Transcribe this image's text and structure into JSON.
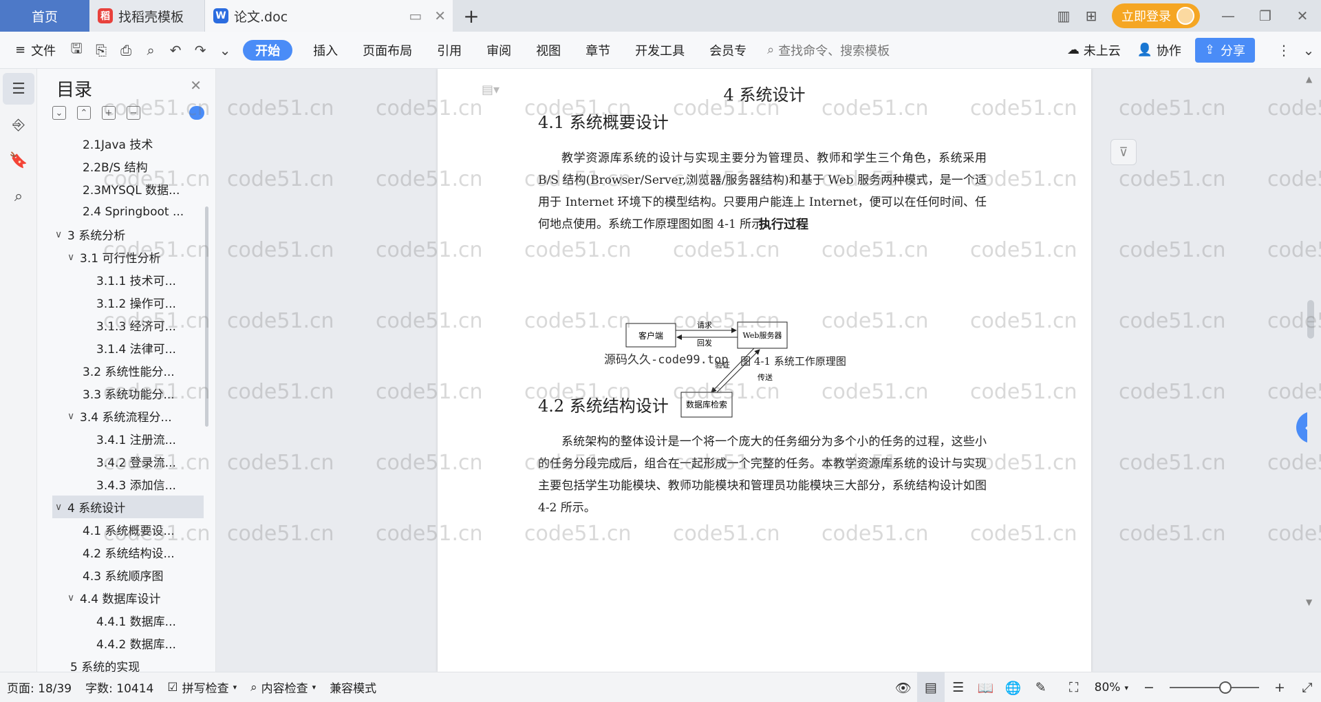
{
  "tabs": {
    "home": "首页",
    "template": "找稻壳模板",
    "doc": "论文.doc",
    "plus": "+"
  },
  "header": {
    "login": "立即登录"
  },
  "ribbon": {
    "file": "文件",
    "tabs": [
      "开始",
      "插入",
      "页面布局",
      "引用",
      "审阅",
      "视图",
      "章节",
      "开发工具",
      "会员专"
    ],
    "search": "查找命令、搜索模板",
    "cloud": "未上云",
    "collab": "协作",
    "share": "分享"
  },
  "toc": {
    "title": "目录",
    "items": [
      {
        "label": "2.1Java 技术",
        "level": 2
      },
      {
        "label": "2.2B/S 结构",
        "level": 2
      },
      {
        "label": "2.3MYSQL 数据...",
        "level": 2
      },
      {
        "label": "2.4 Springboot ...",
        "level": 2
      },
      {
        "label": "3  系统分析",
        "level": 1
      },
      {
        "label": "3.1 可行性分析",
        "level": 2
      },
      {
        "label": "3.1.1 技术可...",
        "level": 3
      },
      {
        "label": "3.1.2 操作可...",
        "level": 3
      },
      {
        "label": "3.1.3 经济可...",
        "level": 3
      },
      {
        "label": "3.1.4 法律可...",
        "level": 3
      },
      {
        "label": "3.2 系统性能分...",
        "level": 2
      },
      {
        "label": "3.3 系统功能分...",
        "level": 2
      },
      {
        "label": "3.4 系统流程分...",
        "level": 2
      },
      {
        "label": "3.4.1 注册流...",
        "level": 3
      },
      {
        "label": "3.4.2 登录流...",
        "level": 3
      },
      {
        "label": "3.4.3 添加信...",
        "level": 3
      },
      {
        "label": "4  系统设计",
        "level": 1
      },
      {
        "label": "4.1 系统概要设...",
        "level": 2
      },
      {
        "label": "4.2 系统结构设...",
        "level": 2
      },
      {
        "label": "4.3  系统顺序图",
        "level": 2
      },
      {
        "label": "4.4 数据库设计",
        "level": 2
      },
      {
        "label": "4.4.1  数据库...",
        "level": 3
      },
      {
        "label": "4.4.2  数据库...",
        "level": 3
      },
      {
        "label": "5  系统的实现",
        "level": 1
      }
    ]
  },
  "document": {
    "chapter_title": "4  系统设计",
    "sec1_title": "4.1 系统概要设计",
    "sec1_para": "教学资源库系统的设计与实现主要分为管理员、教师和学生三个角色，系统采用 B/S 结构(Browser/Server,浏览器/服务器结构)和基于 Web 服务两种模式，是一个适用于 Internet 环境下的模型结构。只要用户能连上 Internet，便可以在任何时间、任何地点使用。系统工作原理图如图 4-1 所示：",
    "figure_title": "执行过程",
    "diagram": {
      "client": "客户端",
      "server": "Web服务器",
      "db": "数据库检索",
      "request": "请求",
      "reply": "回发",
      "verify": "验证",
      "transfer": "传送"
    },
    "source_note": "源码久久-code99.top",
    "figure_caption": "图 4-1  系统工作原理图",
    "sec2_title": "4.2 系统结构设计",
    "sec2_para": "系统架构的整体设计是一个将一个庞大的任务细分为多个小的任务的过程，这些小的任务分段完成后，组合在一起形成一个完整的任务。本教学资源库系统的设计与实现主要包括学生功能模块、教师功能模块和管理员功能模块三大部分，系统结构设计如图 4-2 所示。"
  },
  "watermark": "code51.cn",
  "status": {
    "page": "页面: 18/39",
    "words": "字数: 10414",
    "spell": "拼写检查",
    "content": "内容检查",
    "compat": "兼容模式",
    "zoom": "80%",
    "zoom_level": 0.62
  },
  "colors": {
    "accent": "#4a8cf7",
    "home_tab": "#4d79c8",
    "login": "#f5a623"
  }
}
